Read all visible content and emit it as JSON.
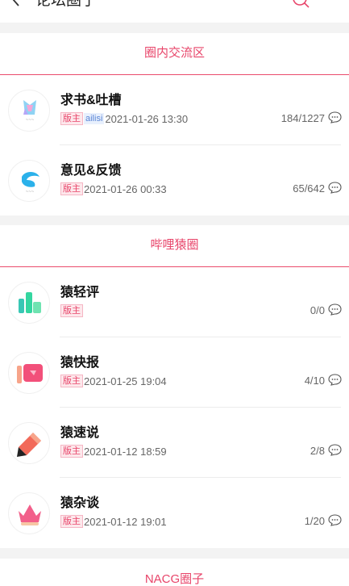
{
  "header": {
    "title": "论坛圈子"
  },
  "sections": [
    {
      "title": "圈内交流区",
      "items": [
        {
          "name": "求书&吐槽",
          "badge": "版主",
          "user": "ailisi",
          "time": "2021-01-26 13:30",
          "count": "184/1227"
        },
        {
          "name": "意见&反馈",
          "badge": "版主",
          "time": "2021-01-26 00:33",
          "count": "65/642"
        }
      ]
    },
    {
      "title": "哔哩猿圈",
      "items": [
        {
          "name": "猿轻评",
          "badge": "版主",
          "time": "",
          "count": "0/0"
        },
        {
          "name": "猿快报",
          "badge": "版主",
          "time": "2021-01-25 19:04",
          "count": "4/10"
        },
        {
          "name": "猿速说",
          "badge": "版主",
          "time": "2021-01-12 18:59",
          "count": "2/8"
        },
        {
          "name": "猿杂谈",
          "badge": "版主",
          "time": "2021-01-12 19:01",
          "count": "1/20"
        }
      ]
    },
    {
      "title": "NACG圈子"
    }
  ],
  "colors": {
    "accent": "#e8456a"
  }
}
